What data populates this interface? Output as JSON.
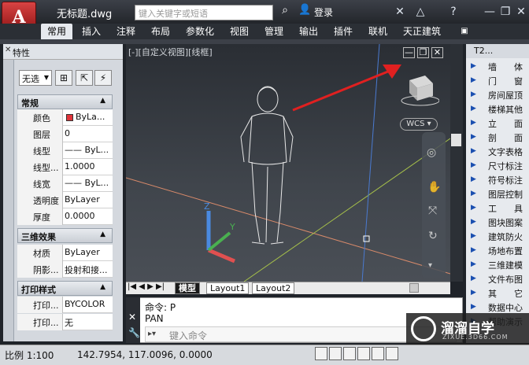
{
  "app": {
    "title": "无标题.dwg",
    "logo_text": "A"
  },
  "search": {
    "placeholder": "键入关键字或短语"
  },
  "account": {
    "login": "登录"
  },
  "ribbon_tabs": [
    "常用",
    "插入",
    "注释",
    "布局",
    "参数化",
    "视图",
    "管理",
    "输出",
    "插件",
    "联机",
    "天正建筑"
  ],
  "properties": {
    "title": "特性",
    "selection": "无选",
    "sections": [
      {
        "title": "常规",
        "rows": [
          {
            "label": "颜色",
            "value": "ByLa..."
          },
          {
            "label": "图层",
            "value": "0"
          },
          {
            "label": "线型",
            "value": "—— ByL..."
          },
          {
            "label": "线型...",
            "value": "1.0000"
          },
          {
            "label": "线宽",
            "value": "—— ByL..."
          },
          {
            "label": "透明度",
            "value": "ByLayer"
          },
          {
            "label": "厚度",
            "value": "0.0000"
          }
        ]
      },
      {
        "title": "三维效果",
        "rows": [
          {
            "label": "材质",
            "value": "ByLayer"
          },
          {
            "label": "阴影...",
            "value": "投射和接..."
          }
        ]
      },
      {
        "title": "打印样式",
        "rows": [
          {
            "label": "打印...",
            "value": "BYCOLOR"
          },
          {
            "label": "打印...",
            "value": "无"
          }
        ]
      }
    ]
  },
  "viewport": {
    "label": "[-][自定义视图][线框]",
    "wcs": "WCS",
    "color_swatch": "#e0343a"
  },
  "layout_tabs": [
    "模型",
    "Layout1",
    "Layout2"
  ],
  "command": {
    "line1": "命令: P",
    "line2": "PAN",
    "placeholder": "键入命令"
  },
  "tool_palette": {
    "title": "T2...",
    "items": [
      "墙　　体",
      "门　　窗",
      "房间屋顶",
      "楼梯其他",
      "立　　面",
      "剖　　面",
      "文字表格",
      "尺寸标注",
      "符号标注",
      "图层控制",
      "工　　具",
      "图块图案",
      "建筑防火",
      "场地布置",
      "三维建模",
      "文件布图",
      "其　　它",
      "数据中心",
      "帮助演示"
    ]
  },
  "status": {
    "scale": "比例 1:100",
    "coords": "142.7954,  117.0096, 0.0000"
  },
  "watermark": {
    "title": "溜溜自学",
    "url": "ZIXUE.3D66.COM"
  }
}
